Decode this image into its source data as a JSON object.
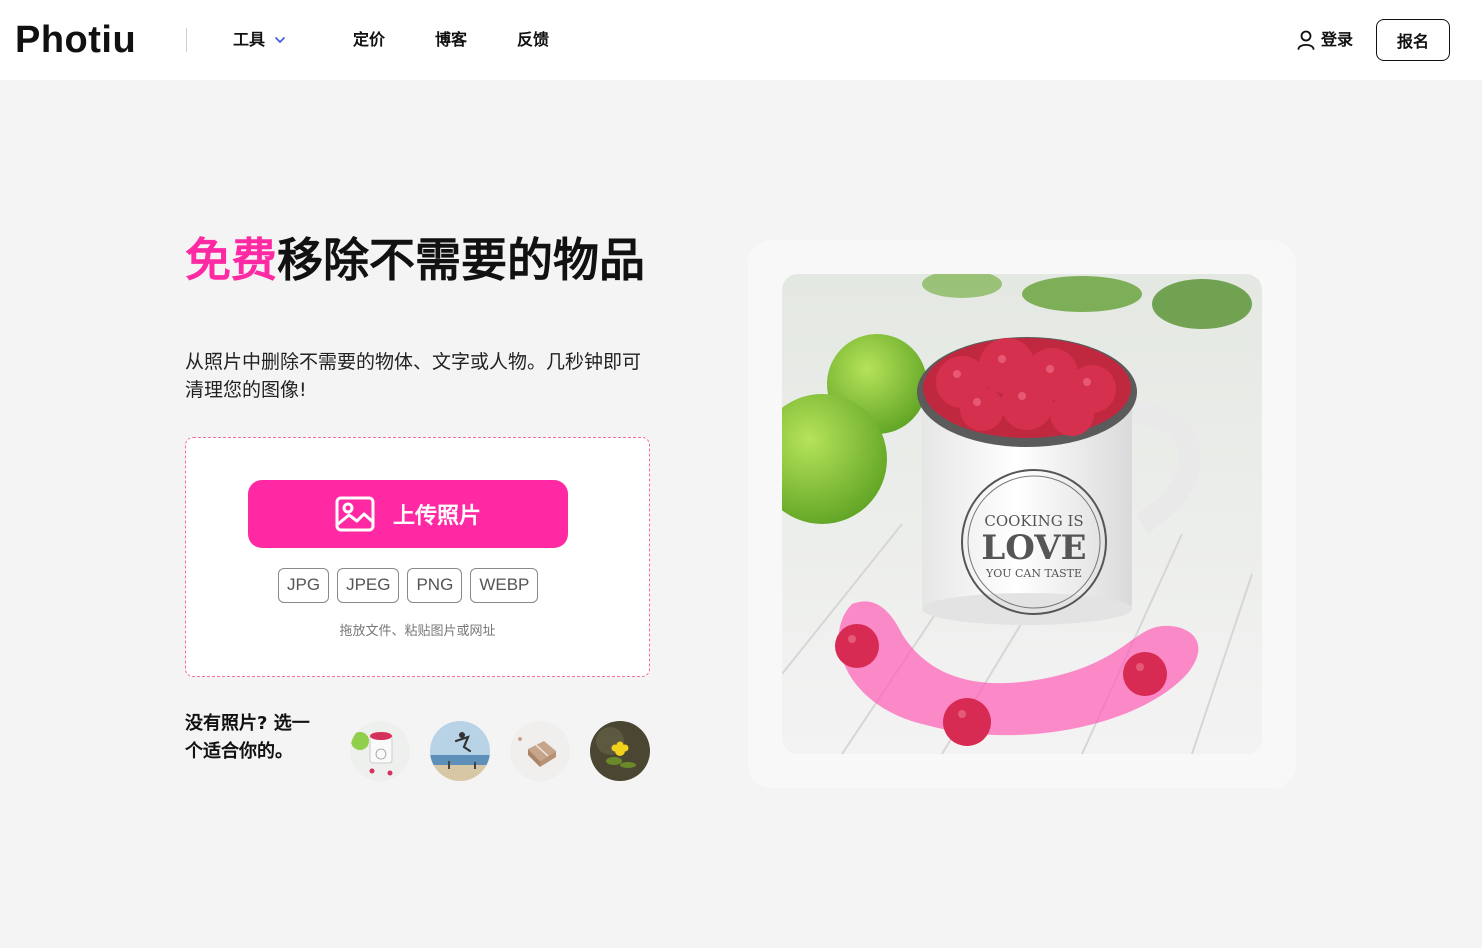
{
  "header": {
    "logo": "Photiu",
    "nav": {
      "tools": "工具",
      "pricing": "定价",
      "blog": "博客",
      "feedback": "反馈"
    },
    "login": "登录",
    "signup": "报名"
  },
  "hero": {
    "title_accent": "免费",
    "title_rest": "移除不需要的物品",
    "subtitle": "从照片中删除不需要的物体、文字或人物。几秒钟即可清理您的图像!",
    "upload_label": "上传照片",
    "formats": [
      "JPG",
      "JPEG",
      "PNG",
      "WEBP"
    ],
    "drop_hint": "拖放文件、粘贴图片或网址"
  },
  "samples": {
    "label": "没有照片? 选一个适合你的。"
  },
  "preview": {
    "mug_text_line1": "COOKING IS",
    "mug_text_line2": "LOVE",
    "mug_text_line3": "YOU CAN TASTE"
  },
  "colors": {
    "accent": "#ff2aa3",
    "background": "#f4f4f5"
  }
}
